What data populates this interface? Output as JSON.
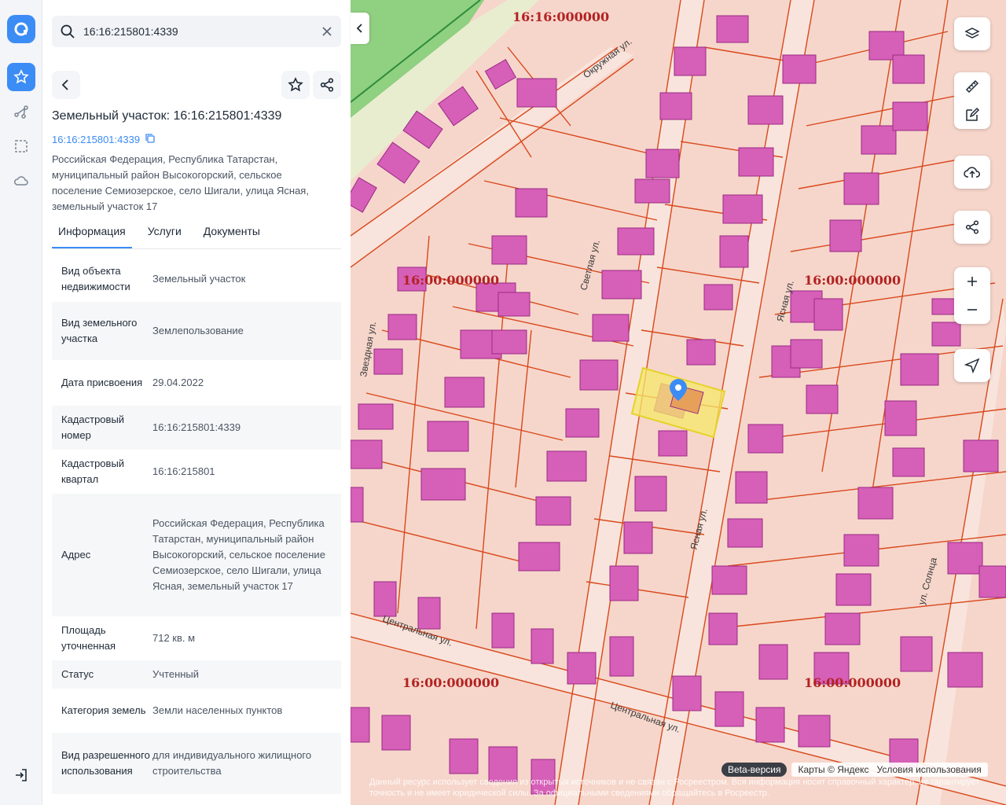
{
  "search": {
    "value": "16:16:215801:4339"
  },
  "parcel": {
    "title": "Земельный участок: 16:16:215801:4339",
    "cad_number": "16:16:215801:4339",
    "address": "Российская Федерация, Республика Татарстан, муниципальный район Высокогорский, сельское поселение Семиозерское, село Шигали, улица Ясная, земельный участок 17"
  },
  "tabs": [
    "Информация",
    "Услуги",
    "Документы"
  ],
  "info": [
    {
      "k": "Вид объекта недвижимости",
      "v": "Земельный участок"
    },
    {
      "k": "Вид земельного участка",
      "v": "Землепользование"
    },
    {
      "k": "Дата присвоения",
      "v": "29.04.2022"
    },
    {
      "k": "Кадастровый номер",
      "v": "16:16:215801:4339"
    },
    {
      "k": "Кадастровый квартал",
      "v": "16:16:215801"
    },
    {
      "k": "Адрес",
      "v": "Российская Федерация, Республика Татарстан, муниципальный район Высокогорский, сельское поселение Семиозерское, село Шигали, улица Ясная, земельный участок 17"
    },
    {
      "k": "Площадь уточненная",
      "v": "712 кв. м"
    },
    {
      "k": "Статус",
      "v": "Учтенный"
    },
    {
      "k": "Категория земель",
      "v": "Земли населенных пунктов"
    },
    {
      "k": "Вид разрешенного использования",
      "v": "для индивидуального жилищного строительства"
    }
  ],
  "map": {
    "quarter_labels": [
      "16:16:000000",
      "16:00:000000",
      "16:00:000000",
      "16:00:000000",
      "16:00:000000"
    ],
    "streets": [
      "Окружная ул.",
      "Светлая ул.",
      "Ясная ул.",
      "Звездная ул.",
      "Центральная ул.",
      "ул. Солнца"
    ],
    "beta": "Beta-версия",
    "copyright": "Карты © Яндекс",
    "terms": "Условия использования",
    "disclaimer": "Данный ресурс использует сведения из открытых источников и не связан с Росреестром. Вся информация носит справочный характер, не гарантирует точность и не имеет юридической силы. За официальными сведениями обращайтесь в Росреестр."
  },
  "colors": {
    "accent": "#3c8cf5",
    "parcel_line": "#d9481c",
    "building": "#d65fb8",
    "selected": "#f5e86a"
  }
}
